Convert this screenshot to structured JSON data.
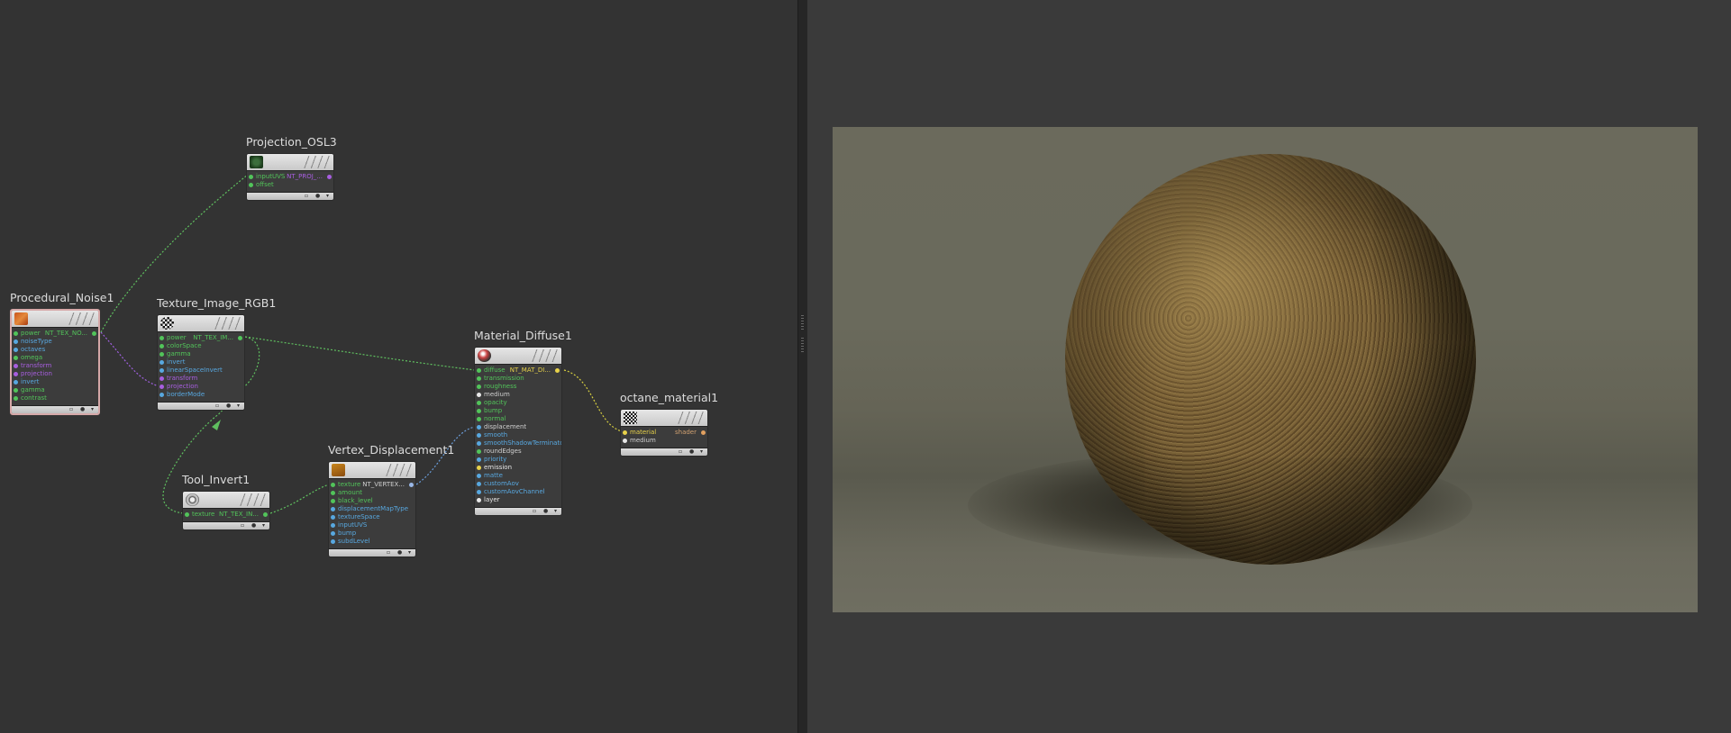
{
  "colors": {
    "texture_port": "#52c45a",
    "value_port": "#58a8e0",
    "transform_port": "#a85ee0",
    "yellow_port": "#e8d24a",
    "white_port": "#e8e8e8",
    "wire_green": "#5fbf5f",
    "wire_purple": "#a060e0",
    "wire_yellow": "#d8d040",
    "wire_blue": "#6a9cd8"
  },
  "nodes": {
    "projection_osl3": {
      "title": "Projection_OSL3",
      "thumb_icon": "projection-icon",
      "output": "NT_PROJ_...",
      "inputs": [
        "inputUVS",
        "offset"
      ]
    },
    "procedural_noise1": {
      "title": "Procedural_Noise1",
      "thumb_icon": "noise-icon",
      "output": "NT_TEX_NO...",
      "inputs": [
        "power",
        "noiseType",
        "octaves",
        "omega",
        "transform",
        "projection",
        "invert",
        "gamma",
        "contrast"
      ]
    },
    "texture_image_rgb1": {
      "title": "Texture_Image_RGB1",
      "thumb_icon": "checker-icon",
      "output": "NT_TEX_IM...",
      "inputs": [
        "power",
        "colorSpace",
        "gamma",
        "invert",
        "linearSpaceInvert",
        "transform",
        "projection",
        "borderMode"
      ]
    },
    "material_diffuse1": {
      "title": "Material_Diffuse1",
      "thumb_icon": "material-ball-icon",
      "output": "NT_MAT_DI...",
      "inputs": [
        "diffuse",
        "transmission",
        "roughness",
        "medium",
        "opacity",
        "bump",
        "normal",
        "displacement",
        "smooth",
        "smoothShadowTerminator",
        "roundEdges",
        "priority",
        "emission",
        "matte",
        "customAov",
        "customAovChannel",
        "layer"
      ]
    },
    "octane_material1": {
      "title": "octane_material1",
      "thumb_icon": "checker-flag-icon",
      "output": "shader",
      "inputs": [
        "material",
        "medium"
      ]
    },
    "vertex_displacement1": {
      "title": "Vertex_Displacement1",
      "thumb_icon": "displacement-icon",
      "output": "NT_VERTEX...",
      "inputs": [
        "texture",
        "amount",
        "black_level",
        "displacementMapType",
        "textureSpace",
        "inputUVS",
        "bump",
        "subdLevel"
      ]
    },
    "tool_invert1": {
      "title": "Tool_Invert1",
      "thumb_icon": "invert-gear-icon",
      "output": "NT_TEX_IN...",
      "inputs": [
        "texture"
      ]
    }
  },
  "footer_glyphs": {
    "a": "▫",
    "b": "●",
    "c": "▾"
  }
}
